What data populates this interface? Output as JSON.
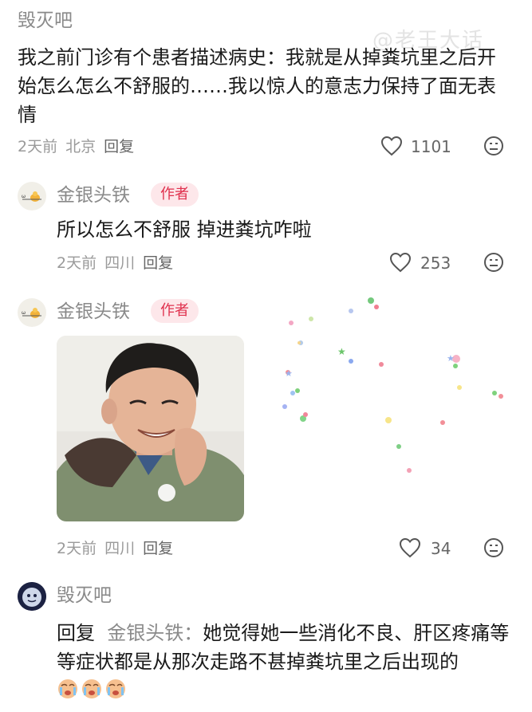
{
  "watermark": "@老王大话",
  "comment1": {
    "username": "毁灭吧",
    "text": "我之前门诊有个患者描述病史：我就是从掉粪坑里之后开始怎么怎么不舒服的……我以惊人的意志力保持了面无表情",
    "time": "2天前",
    "location": "北京",
    "reply_label": "回复",
    "likes": "1101"
  },
  "reply1": {
    "username": "金银头铁",
    "badge": "作者",
    "text": "所以怎么不舒服 掉进粪坑咋啦",
    "time": "2天前",
    "location": "四川",
    "reply_label": "回复",
    "likes": "253"
  },
  "reply2": {
    "username": "金银头铁",
    "badge": "作者",
    "time": "2天前",
    "location": "四川",
    "reply_label": "回复",
    "likes": "34"
  },
  "reply3": {
    "username": "毁灭吧",
    "reply_prefix": "回复",
    "reply_target": "金银头铁：",
    "text": "她觉得她一些消化不良、肝区疼痛等等症状都是从那次走路不甚掉粪坑里之后出现的"
  },
  "icons": {
    "like": "heart-outline-icon",
    "more": "emoji-face-icon",
    "crying": "crying-face-emoji"
  },
  "colors": {
    "badge_bg": "#fde7ea",
    "badge_text": "#e0304d",
    "meta": "#9a9a9a"
  }
}
